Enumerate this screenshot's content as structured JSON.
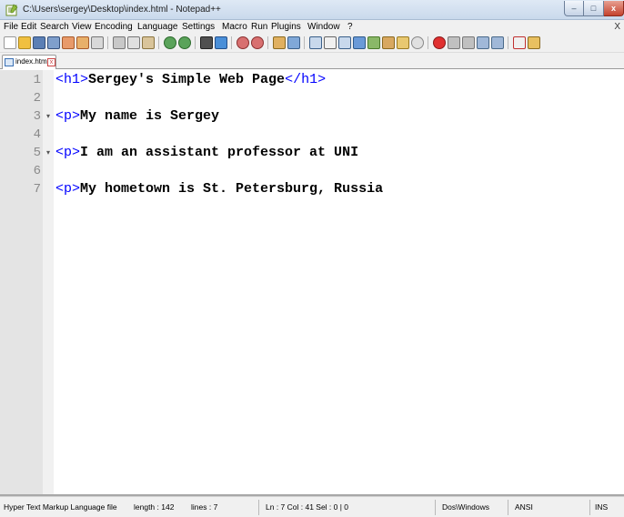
{
  "window": {
    "title": "C:\\Users\\sergey\\Desktop\\index.html - Notepad++",
    "min_glyph": "–",
    "max_glyph": "□",
    "close_glyph": "x"
  },
  "menu": {
    "items": [
      "File",
      "Edit",
      "Search",
      "View",
      "Encoding",
      "Language",
      "Settings",
      "Macro",
      "Run",
      "Plugins",
      "Window",
      "?"
    ],
    "close_glyph": "X"
  },
  "toolbar": {
    "icons": [
      "new-file-icon",
      "open-file-icon",
      "save-icon",
      "save-all-icon",
      "close-icon",
      "close-all-icon",
      "print-icon",
      "cut-icon",
      "copy-icon",
      "paste-icon",
      "undo-icon",
      "redo-icon",
      "find-icon",
      "replace-icon",
      "zoom-in-icon",
      "zoom-out-icon",
      "sync-vertical-icon",
      "sync-horizontal-icon",
      "word-wrap-icon",
      "show-all-chars-icon",
      "indent-guide-icon",
      "user-language-icon",
      "doc-map-icon",
      "function-list-icon",
      "folder-workspace-icon",
      "monitoring-icon",
      "record-macro-icon",
      "stop-macro-icon",
      "play-macro-icon",
      "run-macro-icon",
      "save-macro-icon",
      "spell-check-icon",
      "spell-options-icon"
    ]
  },
  "tabs": [
    {
      "label": "index.html",
      "close_glyph": "x"
    }
  ],
  "editor": {
    "lines": [
      {
        "num": "1",
        "fold": "",
        "open_tag": "<h1>",
        "text": "Sergey's Simple Web Page",
        "close_tag": "</h1>"
      },
      {
        "num": "2",
        "fold": "",
        "open_tag": "",
        "text": "",
        "close_tag": ""
      },
      {
        "num": "3",
        "fold": "▾",
        "open_tag": "<p>",
        "text": "My name is Sergey",
        "close_tag": ""
      },
      {
        "num": "4",
        "fold": "",
        "open_tag": "",
        "text": "",
        "close_tag": ""
      },
      {
        "num": "5",
        "fold": "▾",
        "open_tag": "<p>",
        "text": "I am an assistant professor at UNI",
        "close_tag": ""
      },
      {
        "num": "6",
        "fold": "",
        "open_tag": "",
        "text": "",
        "close_tag": ""
      },
      {
        "num": "7",
        "fold": "",
        "open_tag": "<p>",
        "text": "My hometown is St. Petersburg, Russia",
        "close_tag": ""
      }
    ]
  },
  "status": {
    "file_type": "Hyper Text Markup Language file",
    "length": "length : 142",
    "lines": "lines : 7",
    "position": "Ln : 7   Col : 41   Sel : 0 | 0",
    "eol": "Dos\\Windows",
    "encoding": "ANSI",
    "mode": "INS"
  }
}
